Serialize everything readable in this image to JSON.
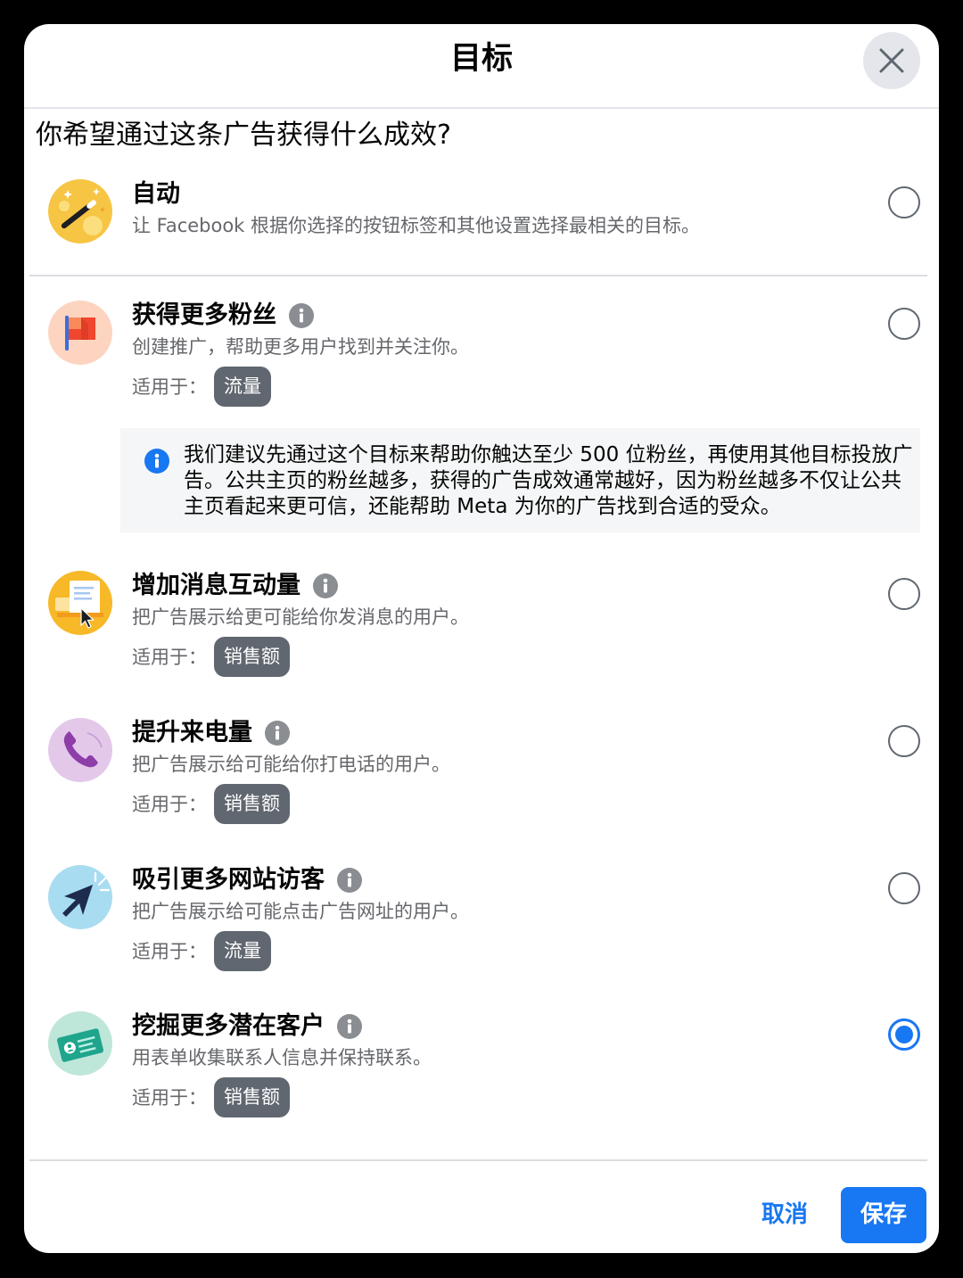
{
  "dialog": {
    "title": "目标",
    "question": "你希望通过这条广告获得什么成效?"
  },
  "icons": {
    "close": "close-icon",
    "info": "info-icon"
  },
  "objectives": [
    {
      "title": "自动",
      "description": "让 Facebook 根据你选择的按钮标签和其他设置选择最相关的目标。",
      "icon": "magic-wand-icon",
      "icon_bg": "#f6c544",
      "selected": false
    },
    {
      "title": "获得更多粉丝",
      "description": "创建推广，帮助更多用户找到并关注你。",
      "applies_label": "适用于：",
      "badge": "流量",
      "icon": "flag-icon",
      "icon_bg": "#fcd4c0",
      "selected": false
    },
    {
      "title": "增加消息互动量",
      "description": "把广告展示给更可能给你发消息的用户。",
      "applies_label": "适用于：",
      "badge": "销售额",
      "icon": "message-card-icon",
      "icon_bg": "#f7b928",
      "selected": false
    },
    {
      "title": "提升来电量",
      "description": "把广告展示给可能给你打电话的用户。",
      "applies_label": "适用于：",
      "badge": "销售额",
      "icon": "phone-icon",
      "icon_bg": "#e3c8ea",
      "selected": false
    },
    {
      "title": "吸引更多网站访客",
      "description": "把广告展示给可能点击广告网址的用户。",
      "applies_label": "适用于：",
      "badge": "流量",
      "icon": "cursor-click-icon",
      "icon_bg": "#a8dcf1",
      "selected": false
    },
    {
      "title": "挖掘更多潜在客户",
      "description": "用表单收集联系人信息并保持联系。",
      "applies_label": "适用于：",
      "badge": "销售额",
      "icon": "contact-card-icon",
      "icon_bg": "#bfe7d9",
      "selected": true
    }
  ],
  "notice": {
    "icon": "info-icon",
    "text": "我们建议先通过这个目标来帮助你触达至少 500 位粉丝，再使用其他目标投放广告。公共主页的粉丝越多，获得的广告成效通常越好，因为粉丝越多不仅让公共主页看起来更可信，还能帮助 Meta 为你的广告找到合适的受众。"
  },
  "footer": {
    "cancel_label": "取消",
    "save_label": "保存"
  },
  "colors": {
    "accent": "#1877f2",
    "text_primary": "#050505",
    "text_secondary": "#65676b",
    "badge_bg": "#606770",
    "notice_bg": "#f5f6f7",
    "close_bg": "#e4e6eb"
  }
}
